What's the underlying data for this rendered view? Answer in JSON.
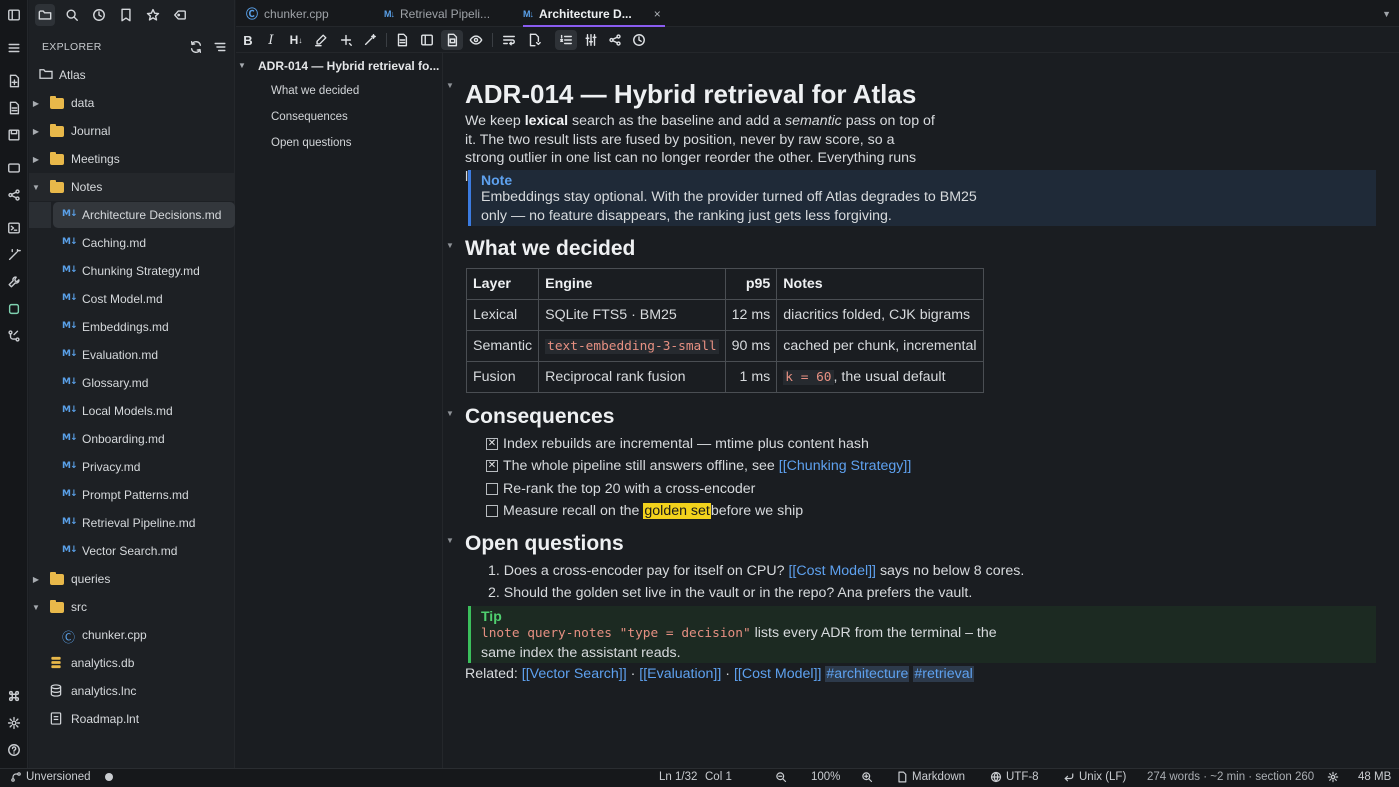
{
  "tabs": [
    {
      "label": "chunker.cpp",
      "icon": "cpp-icon"
    },
    {
      "label": "Retrieval Pipeli...",
      "icon": "markdown-icon"
    },
    {
      "label": "Architecture D...",
      "icon": "markdown-icon",
      "close": "×"
    }
  ],
  "sidebar": {
    "header": "EXPLORER",
    "tree": [
      {
        "label": "Atlas",
        "type": "root"
      },
      {
        "label": "data",
        "type": "folder"
      },
      {
        "label": "Journal",
        "type": "folder"
      },
      {
        "label": "Meetings",
        "type": "folder"
      },
      {
        "label": "Notes",
        "type": "folder-open"
      },
      {
        "label": "Architecture Decisions.md",
        "type": "md"
      },
      {
        "label": "Caching.md",
        "type": "md"
      },
      {
        "label": "Chunking Strategy.md",
        "type": "md"
      },
      {
        "label": "Cost Model.md",
        "type": "md"
      },
      {
        "label": "Embeddings.md",
        "type": "md"
      },
      {
        "label": "Evaluation.md",
        "type": "md"
      },
      {
        "label": "Glossary.md",
        "type": "md"
      },
      {
        "label": "Local Models.md",
        "type": "md"
      },
      {
        "label": "Onboarding.md",
        "type": "md"
      },
      {
        "label": "Privacy.md",
        "type": "md"
      },
      {
        "label": "Prompt Patterns.md",
        "type": "md"
      },
      {
        "label": "Retrieval Pipeline.md",
        "type": "md"
      },
      {
        "label": "Vector Search.md",
        "type": "md"
      },
      {
        "label": "queries",
        "type": "folder"
      },
      {
        "label": "src",
        "type": "folder-open"
      },
      {
        "label": "chunker.cpp",
        "type": "cpp"
      },
      {
        "label": "analytics.db",
        "type": "db"
      },
      {
        "label": "analytics.lnc",
        "type": "lnc"
      },
      {
        "label": "Roadmap.lnt",
        "type": "lnt"
      }
    ]
  },
  "outline": {
    "title": "ADR-014 — Hybrid retrieval fo...",
    "items": [
      "What we decided",
      "Consequences",
      "Open questions"
    ]
  },
  "doc": {
    "h1": "ADR-014 — Hybrid retrieval for Atlas",
    "intro": {
      "p1": "We keep ",
      "b1": "lexical",
      "p2": " search as the baseline and add a ",
      "i1": "semantic",
      "p3": " pass on top of it. The two result lists are fused by position, never by raw score, so a strong outlier in one list can no longer reorder the other. Everything runs locally."
    },
    "note": {
      "title": "Note",
      "body": "Embeddings stay optional. With the provider turned off Atlas degrades to BM25 only — no feature disappears, the ranking just gets less forgiving."
    },
    "h2_decided": "What we decided",
    "table": {
      "headers": [
        "Layer",
        "Engine",
        "p95",
        "Notes"
      ],
      "rows": [
        {
          "layer": "Lexical",
          "engine": "SQLite FTS5 · BM25",
          "p95": "12 ms",
          "notes": "diacritics folded, CJK bigrams"
        },
        {
          "layer": "Semantic",
          "engine": "text-embedding-3-small",
          "p95": "90 ms",
          "notes": "cached per chunk, incremental"
        },
        {
          "layer": "Fusion",
          "engine": "Reciprocal rank fusion",
          "p95": "1 ms",
          "notes_code": "k = 60",
          "notes": ", the usual default"
        }
      ]
    },
    "h2_consequences": "Consequences",
    "tasks": [
      {
        "checked": true,
        "text": "Index rebuilds are incremental — mtime plus content hash"
      },
      {
        "checked": true,
        "text": "The whole pipeline still answers offline, see ",
        "link": "[[Chunking Strategy]]"
      },
      {
        "checked": false,
        "text": "Re-rank the top 20 with a cross-encoder"
      },
      {
        "checked": false,
        "text": "Measure recall on the ",
        "highlight": "golden set",
        "after": " before we ship"
      }
    ],
    "checkmark": "✕",
    "h2_open": "Open questions",
    "questions": [
      {
        "num": "1.",
        "pre": "Does a cross-encoder pay for itself on CPU? ",
        "link": "[[Cost Model]]",
        "post": " says no below 8 cores."
      },
      {
        "num": "2.",
        "pre": "Should the golden set live in the vault or in the repo? Ana prefers the vault."
      }
    ],
    "tip": {
      "title": "Tip",
      "code": "lnote query-notes \"type = decision\"",
      "body1": " lists every ADR from the terminal – the",
      "body2": "same index the assistant reads."
    },
    "related": {
      "label": "Related: ",
      "links": [
        "[[Vector Search]]",
        "[[Evaluation]]",
        "[[Cost Model]]"
      ],
      "sep": " · ",
      "tags": [
        "#architecture",
        "#retrieval"
      ]
    }
  },
  "status": {
    "vcs": "Unversioned",
    "position": "Ln 1/32",
    "col": "Col 1",
    "zoom": "100%",
    "mode": "Markdown",
    "encoding": "UTF-8",
    "eol": "Unix (LF)",
    "stats": "274 words · ~2 min · section 260",
    "memory": "48 MB"
  },
  "colors": {
    "accent": "#8a5cf0",
    "link": "#5ea1ef",
    "note": "#3b7be0",
    "tip": "#3bbf5c",
    "highlight": "#f2d21c",
    "folder": "#e8b84a"
  }
}
